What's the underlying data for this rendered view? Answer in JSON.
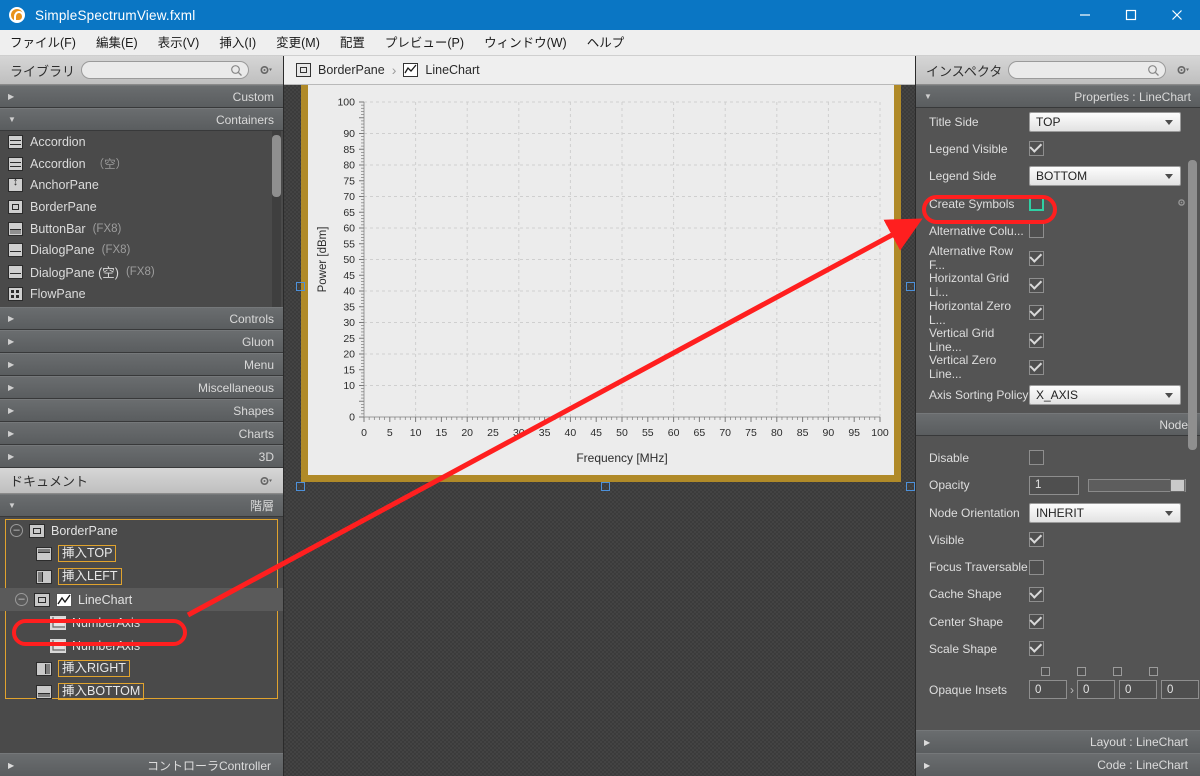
{
  "window": {
    "title": "SimpleSpectrumView.fxml",
    "app_icon": "scenebuilder-icon",
    "minimize": "–",
    "maximize": "□",
    "close": "✕"
  },
  "menubar": {
    "items": [
      {
        "label": "ファイル(F)"
      },
      {
        "label": "編集(E)"
      },
      {
        "label": "表示(V)"
      },
      {
        "label": "挿入(I)"
      },
      {
        "label": "変更(M)"
      },
      {
        "label": "配置"
      },
      {
        "label": "プレビュー(P)"
      },
      {
        "label": "ウィンドウ(W)"
      },
      {
        "label": "ヘルプ"
      }
    ]
  },
  "library": {
    "title": "ライブラリ",
    "search_placeholder": "",
    "search_value": "",
    "sections_top": [
      {
        "label": "Custom",
        "expanded": false
      },
      {
        "label": "Containers",
        "expanded": true
      }
    ],
    "items": [
      {
        "label": "Accordion",
        "suffix": "",
        "icon": "accordion-icon"
      },
      {
        "label": "Accordion",
        "suffix": "（空）",
        "icon": "accordion-icon"
      },
      {
        "label": "AnchorPane",
        "suffix": "",
        "icon": "anchorpane-icon"
      },
      {
        "label": "BorderPane",
        "suffix": "",
        "icon": "borderpane-icon"
      },
      {
        "label": "ButtonBar",
        "suffix": "(FX8)",
        "icon": "buttonbar-icon"
      },
      {
        "label": "DialogPane",
        "suffix": "(FX8)",
        "icon": "dialogpane-icon"
      },
      {
        "label": "DialogPane (空)",
        "suffix": "(FX8)",
        "icon": "dialogpane-icon"
      },
      {
        "label": "FlowPane",
        "suffix": "",
        "icon": "flowpane-icon"
      }
    ],
    "sections_bottom": [
      {
        "label": "Controls",
        "expanded": false
      },
      {
        "label": "Gluon",
        "expanded": false
      },
      {
        "label": "Menu",
        "expanded": false
      },
      {
        "label": "Miscellaneous",
        "expanded": false
      },
      {
        "label": "Shapes",
        "expanded": false
      },
      {
        "label": "Charts",
        "expanded": false
      },
      {
        "label": "3D",
        "expanded": false
      }
    ]
  },
  "document": {
    "title": "ドキュメント",
    "hierarchy_label": "階層",
    "controller_label": "コントローラController",
    "tree": [
      {
        "label": "BorderPane",
        "depth": 0,
        "icon": "borderpane-icon",
        "expander": "–",
        "chip": false,
        "selected": false
      },
      {
        "label": "挿入TOP",
        "depth": 1,
        "icon": "region-top-icon",
        "expander": "",
        "chip": true,
        "selected": false
      },
      {
        "label": "挿入LEFT",
        "depth": 1,
        "icon": "region-left-icon",
        "expander": "",
        "chip": true,
        "selected": false
      },
      {
        "label": "LineChart",
        "depth": 1,
        "icon": "linechart-icon",
        "expander": "–",
        "chip": false,
        "selected": true
      },
      {
        "label": "NumberAxis",
        "depth": 2,
        "icon": "axis-icon",
        "expander": "",
        "chip": false,
        "selected": false
      },
      {
        "label": "NumberAxis",
        "depth": 2,
        "icon": "axis-icon",
        "expander": "",
        "chip": false,
        "selected": false
      },
      {
        "label": "挿入RIGHT",
        "depth": 1,
        "icon": "region-right-icon",
        "expander": "",
        "chip": true,
        "selected": false
      },
      {
        "label": "挿入BOTTOM",
        "depth": 1,
        "icon": "region-bottom-icon",
        "expander": "",
        "chip": true,
        "selected": false
      }
    ]
  },
  "breadcrumb": {
    "items": [
      {
        "label": "BorderPane",
        "icon": "borderpane-icon"
      },
      {
        "label": "LineChart",
        "icon": "linechart-icon"
      }
    ],
    "separator": "›"
  },
  "inspector": {
    "title": "インスペクタ",
    "search_placeholder": "",
    "search_value": "",
    "properties_header": "Properties : LineChart",
    "node_header": "Node",
    "layout_footer": "Layout : LineChart",
    "code_footer": "Code : LineChart",
    "highlight_color": "#ff1f1f",
    "focus_color": "#2fd0a4",
    "properties": [
      {
        "label": "Title Side",
        "type": "combo",
        "value": "TOP"
      },
      {
        "label": "Legend Visible",
        "type": "checkbox",
        "value": true
      },
      {
        "label": "Legend Side",
        "type": "combo",
        "value": "BOTTOM"
      },
      {
        "label": "Create Symbols",
        "type": "checkbox",
        "value": false,
        "focused": true,
        "gear": true
      },
      {
        "label": "Alternative Colu...",
        "type": "checkbox",
        "value": false
      },
      {
        "label": "Alternative Row F...",
        "type": "checkbox",
        "value": true
      },
      {
        "label": "Horizontal Grid Li...",
        "type": "checkbox",
        "value": true
      },
      {
        "label": "Horizontal Zero L...",
        "type": "checkbox",
        "value": true
      },
      {
        "label": "Vertical Grid Line...",
        "type": "checkbox",
        "value": true
      },
      {
        "label": "Vertical Zero Line...",
        "type": "checkbox",
        "value": true
      },
      {
        "label": "Axis Sorting Policy",
        "type": "combo",
        "value": "X_AXIS"
      }
    ],
    "node_properties": [
      {
        "label": "Disable",
        "type": "checkbox",
        "value": false
      },
      {
        "label": "Opacity",
        "type": "text-slider",
        "value": "1"
      },
      {
        "label": "Node Orientation",
        "type": "combo",
        "value": "INHERIT"
      },
      {
        "label": "Visible",
        "type": "checkbox",
        "value": true
      },
      {
        "label": "Focus Traversable",
        "type": "checkbox",
        "value": false
      },
      {
        "label": "Cache Shape",
        "type": "checkbox",
        "value": true
      },
      {
        "label": "Center Shape",
        "type": "checkbox",
        "value": true
      },
      {
        "label": "Scale Shape",
        "type": "checkbox",
        "value": true
      }
    ],
    "opaque_insets": {
      "label": "Opaque Insets",
      "values": [
        "0",
        "0",
        "0",
        "0"
      ],
      "separator": "›"
    }
  },
  "chart_data": {
    "type": "line",
    "title": "",
    "xlabel": "Frequency [MHz]",
    "ylabel": "Power [dBm]",
    "xlim": [
      0,
      100
    ],
    "ylim": [
      0,
      100
    ],
    "xticks": [
      0,
      5,
      10,
      15,
      20,
      25,
      30,
      35,
      40,
      45,
      50,
      55,
      60,
      65,
      70,
      75,
      80,
      85,
      90,
      95,
      100
    ],
    "yticks": [
      0,
      10,
      15,
      20,
      25,
      30,
      35,
      40,
      45,
      50,
      55,
      60,
      65,
      70,
      75,
      80,
      85,
      90,
      100
    ],
    "grid": true,
    "legend": false,
    "series": [],
    "background": "#ececec",
    "plot_background": "#ececec"
  },
  "annotation": {
    "color": "#ff1f1f",
    "type": "arrow-pointer",
    "from": "tree-linechart-node",
    "to": "create-symbols-checkbox"
  }
}
